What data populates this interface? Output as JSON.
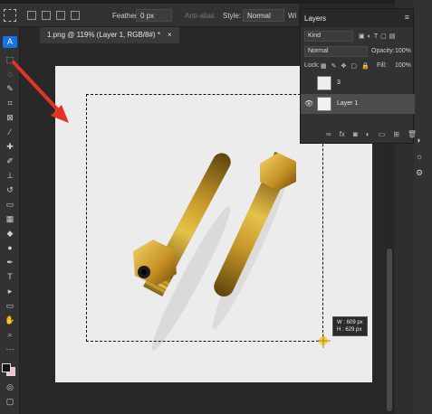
{
  "options": {
    "feather_label": "Feather:",
    "feather_value": "0 px",
    "antialias_label": "Anti-alias",
    "style_label": "Style:",
    "style_value": "Normal",
    "width_label": "Wi"
  },
  "document": {
    "tab_label": "1.png @ 119% (Layer 1, RGB/8#) *",
    "close": "×"
  },
  "tooltip": {
    "w": "W : 609 px",
    "h": "H : 629 px"
  },
  "layers": {
    "title": "Layers",
    "filter_kind": "Kind",
    "blend_mode": "Normal",
    "opacity_label": "Opacity:",
    "opacity_value": "100%",
    "lock_label": "Lock:",
    "fill_label": "Fill:",
    "fill_value": "100%",
    "items": [
      {
        "name": "3",
        "visible": false
      },
      {
        "name": "Layer 1",
        "visible": true
      }
    ]
  },
  "colors": {
    "accent": "#1473e6",
    "arrow": "#e53225",
    "foreground": "#111111",
    "background": "#f2c0c8"
  }
}
